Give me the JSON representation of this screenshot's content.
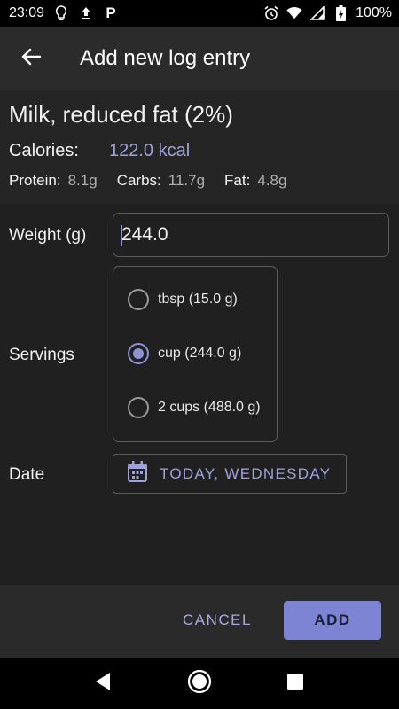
{
  "status_bar": {
    "time": "23:09",
    "battery": "100%",
    "icons_left": [
      "lightbulb-icon",
      "upload-icon",
      "parking-icon"
    ],
    "icons_right": [
      "alarm-icon",
      "wifi-icon",
      "signal-icon",
      "battery-icon"
    ],
    "parking_letter": "P"
  },
  "app_bar": {
    "title": "Add new log entry",
    "back_icon": "arrow-left-icon"
  },
  "food": {
    "name": "Milk, reduced fat (2%)",
    "calories_label": "Calories:",
    "calories_value": "122.0 kcal",
    "protein_label": "Protein:",
    "protein_value": "8.1g",
    "carbs_label": "Carbs:",
    "carbs_value": "11.7g",
    "fat_label": "Fat:",
    "fat_value": "4.8g"
  },
  "form": {
    "weight_label": "Weight (g)",
    "weight_value": "244.0",
    "servings_label": "Servings",
    "servings": [
      {
        "label": "tbsp (15.0 g)",
        "selected": false
      },
      {
        "label": "cup (244.0 g)",
        "selected": true
      },
      {
        "label": "2 cups (488.0 g)",
        "selected": false
      }
    ],
    "date_label": "Date",
    "date_value": "TODAY, WEDNESDAY",
    "date_icon": "calendar-icon"
  },
  "actions": {
    "cancel_label": "CANCEL",
    "add_label": "ADD"
  },
  "nav": {
    "icons": [
      "back-triangle-icon",
      "home-circle-icon",
      "recents-square-icon"
    ]
  },
  "colors": {
    "accent": "#8c92d6",
    "add_button": "#7d84d3",
    "app_bar": "#2b2b2b",
    "background": "#202020"
  }
}
